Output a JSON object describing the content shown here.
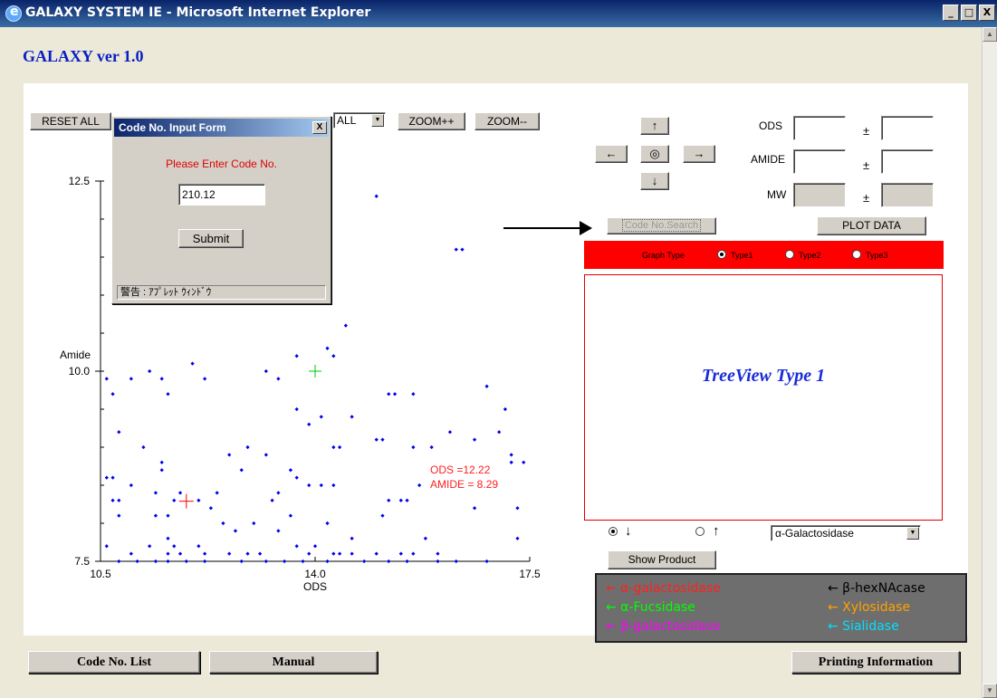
{
  "window": {
    "title": "GALAXY SYSTEM IE - Microsoft Internet Explorer",
    "min": "_",
    "max": "□",
    "close": "X"
  },
  "app_title": "GALAXY ver 1.0",
  "toolbar": {
    "reset_all": "RESET ALL",
    "filter_value": "ALL",
    "zoom_in": "ZOOM++",
    "zoom_out": "ZOOM--"
  },
  "nav": {
    "up": "↑",
    "left": "←",
    "center": "◎",
    "right": "→",
    "down": "↓"
  },
  "params": {
    "ods_label": "ODS",
    "amide_label": "AMIDE",
    "mw_label": "MW",
    "pm": "±"
  },
  "buttons": {
    "code_search": "Code No.Search",
    "plot_data": "PLOT DATA",
    "show_product": "Show Product"
  },
  "graph_type": {
    "label": "Graph Type",
    "options": [
      "Type1",
      "Type2",
      "Type3"
    ],
    "selected": 0
  },
  "treeview": {
    "title": "TreeView Type 1"
  },
  "direction": {
    "down": "↓",
    "up": "↑",
    "selected": "down"
  },
  "enzyme_select": {
    "value": "α-Galactosidase"
  },
  "legend": [
    {
      "text": "← α-galactosidase",
      "color": "#ff2020"
    },
    {
      "text": "← β-hexNAcase",
      "color": "#000000"
    },
    {
      "text": "← α-Fucsidase",
      "color": "#00ff00"
    },
    {
      "text": "← Xylosidase",
      "color": "#ffa000"
    },
    {
      "text": "← β-galactosidase",
      "color": "#ff00ff"
    },
    {
      "text": "← Sialidase",
      "color": "#00e0ff"
    }
  ],
  "modal": {
    "title": "Code No. Input Form",
    "close": "X",
    "prompt": "Please Enter Code No.",
    "code_value": "210.12",
    "submit": "Submit",
    "warning": "警告 : ｱﾌﾟﾚｯﾄ ｳｨﾝﾄﾞｳ"
  },
  "bottom": {
    "code_list": "Code No. List",
    "manual": "Manual",
    "printing": "Printing Information"
  },
  "colors": {
    "point": "#0000ee",
    "highlight_cross": "#ff0000",
    "selected_cross": "#00cc00",
    "title_blue": "#0a1fc4",
    "graph_type_bg": "#ff0000"
  },
  "chart_data": {
    "type": "scatter",
    "xlabel": "ODS",
    "ylabel": "Amide",
    "xlim": [
      10.5,
      17.5
    ],
    "ylim": [
      7.5,
      12.5
    ],
    "xticks": [
      "10.5",
      "14.0",
      "17.5"
    ],
    "yticks": [
      "7.5",
      "10.0",
      "12.5"
    ],
    "annotation": {
      "line1": "ODS =12.22",
      "line2": "AMIDE = 8.29",
      "x": 11.9,
      "y": 8.29
    },
    "selected_point": {
      "x": 14.0,
      "y": 10.0
    },
    "points": [
      [
        15.0,
        12.3
      ],
      [
        16.3,
        11.6
      ],
      [
        16.4,
        11.6
      ],
      [
        14.5,
        10.6
      ],
      [
        14.2,
        10.3
      ],
      [
        13.7,
        10.2
      ],
      [
        14.3,
        10.2
      ],
      [
        12.0,
        10.1
      ],
      [
        11.3,
        10.0
      ],
      [
        13.2,
        10.0
      ],
      [
        12.2,
        9.9
      ],
      [
        13.4,
        9.9
      ],
      [
        10.6,
        9.9
      ],
      [
        11.0,
        9.9
      ],
      [
        11.5,
        9.9
      ],
      [
        10.7,
        9.7
      ],
      [
        11.6,
        9.7
      ],
      [
        15.2,
        9.7
      ],
      [
        15.3,
        9.7
      ],
      [
        15.6,
        9.7
      ],
      [
        16.8,
        9.8
      ],
      [
        17.1,
        9.5
      ],
      [
        13.7,
        9.5
      ],
      [
        14.1,
        9.4
      ],
      [
        14.6,
        9.4
      ],
      [
        13.9,
        9.3
      ],
      [
        16.2,
        9.2
      ],
      [
        16.6,
        9.1
      ],
      [
        17.0,
        9.2
      ],
      [
        10.8,
        9.2
      ],
      [
        15.0,
        9.1
      ],
      [
        15.1,
        9.1
      ],
      [
        14.3,
        9.0
      ],
      [
        14.4,
        9.0
      ],
      [
        11.2,
        9.0
      ],
      [
        12.9,
        9.0
      ],
      [
        12.6,
        8.9
      ],
      [
        17.2,
        8.9
      ],
      [
        15.6,
        9.0
      ],
      [
        15.9,
        9.0
      ],
      [
        13.2,
        8.9
      ],
      [
        11.5,
        8.8
      ],
      [
        11.5,
        8.7
      ],
      [
        12.8,
        8.7
      ],
      [
        17.2,
        8.8
      ],
      [
        17.4,
        8.8
      ],
      [
        13.6,
        8.7
      ],
      [
        13.7,
        8.6
      ],
      [
        10.6,
        8.6
      ],
      [
        10.7,
        8.6
      ],
      [
        13.9,
        8.5
      ],
      [
        14.3,
        8.5
      ],
      [
        11.0,
        8.5
      ],
      [
        14.1,
        8.5
      ],
      [
        11.4,
        8.4
      ],
      [
        12.4,
        8.4
      ],
      [
        13.4,
        8.4
      ],
      [
        15.7,
        8.5
      ],
      [
        11.8,
        8.4
      ],
      [
        11.7,
        8.3
      ],
      [
        12.1,
        8.3
      ],
      [
        10.7,
        8.3
      ],
      [
        10.8,
        8.3
      ],
      [
        12.3,
        8.2
      ],
      [
        13.3,
        8.3
      ],
      [
        15.2,
        8.3
      ],
      [
        15.4,
        8.3
      ],
      [
        15.5,
        8.3
      ],
      [
        11.6,
        8.1
      ],
      [
        11.4,
        8.1
      ],
      [
        13.6,
        8.1
      ],
      [
        16.6,
        8.2
      ],
      [
        15.1,
        8.1
      ],
      [
        17.3,
        8.2
      ],
      [
        10.8,
        8.1
      ],
      [
        13.0,
        8.0
      ],
      [
        12.5,
        8.0
      ],
      [
        14.2,
        8.0
      ],
      [
        13.4,
        7.9
      ],
      [
        12.7,
        7.9
      ],
      [
        15.8,
        7.8
      ],
      [
        11.6,
        7.8
      ],
      [
        14.6,
        7.8
      ],
      [
        17.3,
        7.8
      ],
      [
        10.6,
        7.7
      ],
      [
        11.3,
        7.7
      ],
      [
        11.7,
        7.7
      ],
      [
        12.1,
        7.7
      ],
      [
        13.7,
        7.7
      ],
      [
        14.0,
        7.7
      ],
      [
        11.0,
        7.6
      ],
      [
        11.6,
        7.6
      ],
      [
        12.2,
        7.6
      ],
      [
        12.6,
        7.6
      ],
      [
        14.4,
        7.6
      ],
      [
        15.0,
        7.6
      ],
      [
        15.4,
        7.6
      ],
      [
        15.6,
        7.6
      ],
      [
        12.9,
        7.6
      ],
      [
        13.1,
        7.6
      ],
      [
        13.9,
        7.6
      ],
      [
        14.3,
        7.6
      ],
      [
        14.6,
        7.6
      ],
      [
        16.0,
        7.6
      ],
      [
        11.8,
        7.6
      ],
      [
        10.8,
        7.5
      ],
      [
        11.6,
        7.5
      ],
      [
        11.9,
        7.5
      ],
      [
        12.2,
        7.5
      ],
      [
        12.8,
        7.5
      ],
      [
        13.2,
        7.5
      ],
      [
        13.5,
        7.5
      ],
      [
        13.8,
        7.5
      ],
      [
        14.2,
        7.5
      ],
      [
        14.8,
        7.5
      ],
      [
        15.2,
        7.5
      ],
      [
        15.5,
        7.5
      ],
      [
        16.0,
        7.5
      ],
      [
        16.3,
        7.5
      ],
      [
        16.8,
        7.5
      ],
      [
        11.1,
        7.5
      ],
      [
        11.4,
        7.5
      ]
    ]
  }
}
